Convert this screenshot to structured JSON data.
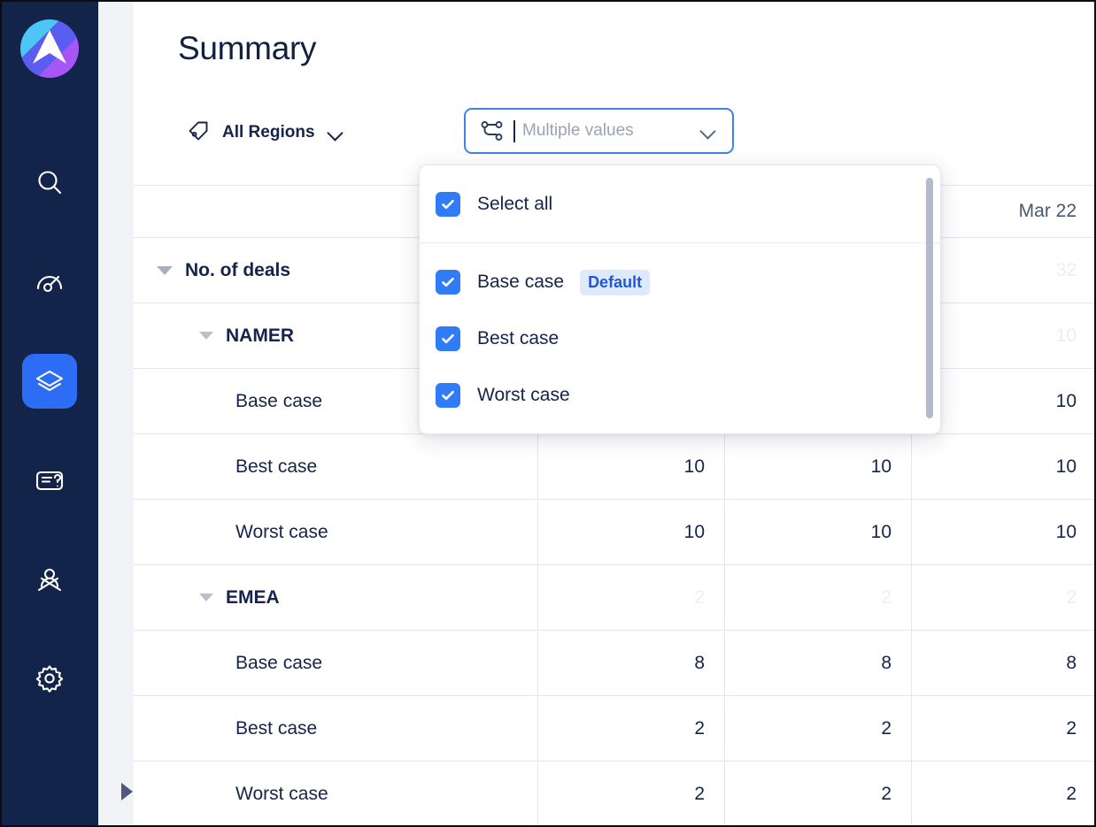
{
  "sidebar": {
    "logo_name": "atlas-logo",
    "items": [
      {
        "name": "search",
        "icon": "search-icon",
        "active": false
      },
      {
        "name": "dashboard",
        "icon": "gauge-icon",
        "active": false
      },
      {
        "name": "models",
        "icon": "layers-icon",
        "active": true
      },
      {
        "name": "help",
        "icon": "help-card-icon",
        "active": false
      },
      {
        "name": "people",
        "icon": "people-icon",
        "active": false
      },
      {
        "name": "settings",
        "icon": "gear-icon",
        "active": false
      }
    ]
  },
  "header": {
    "title": "Summary",
    "region_filter": {
      "label": "All Regions",
      "icon": "tag-icon"
    },
    "scenario_filter": {
      "placeholder": "Multiple values",
      "icon": "branch-icon"
    }
  },
  "dropdown": {
    "select_all_label": "Select all",
    "select_all_checked": true,
    "options": [
      {
        "label": "Base case",
        "badge": "Default",
        "checked": true
      },
      {
        "label": "Best case",
        "badge": "",
        "checked": true
      },
      {
        "label": "Worst case",
        "badge": "",
        "checked": true
      }
    ]
  },
  "table": {
    "columns": [
      "",
      "",
      "",
      "Mar 22"
    ],
    "rows": [
      {
        "label": "No. of deals",
        "indent": 0,
        "bold": true,
        "expander": "down",
        "faded": true,
        "values": [
          "",
          "",
          "32"
        ]
      },
      {
        "label": "NAMER",
        "indent": 1,
        "bold": true,
        "expander": "down",
        "faded": true,
        "values": [
          "",
          "",
          "10"
        ]
      },
      {
        "label": "Base case",
        "indent": 2,
        "bold": false,
        "expander": "",
        "faded": false,
        "values": [
          "",
          "",
          "10"
        ]
      },
      {
        "label": "Best case",
        "indent": 2,
        "bold": false,
        "expander": "",
        "faded": false,
        "values": [
          "10",
          "10",
          "10"
        ]
      },
      {
        "label": "Worst case",
        "indent": 2,
        "bold": false,
        "expander": "",
        "faded": false,
        "values": [
          "10",
          "10",
          "10"
        ]
      },
      {
        "label": "EMEA",
        "indent": 1,
        "bold": true,
        "expander": "down",
        "faded": true,
        "values": [
          "2",
          "2",
          "2"
        ]
      },
      {
        "label": "Base case",
        "indent": 2,
        "bold": false,
        "expander": "",
        "faded": false,
        "values": [
          "8",
          "8",
          "8"
        ]
      },
      {
        "label": "Best case",
        "indent": 2,
        "bold": false,
        "expander": "",
        "faded": false,
        "values": [
          "2",
          "2",
          "2"
        ]
      },
      {
        "label": "Worst case",
        "indent": 2,
        "bold": false,
        "expander": "",
        "faded": false,
        "values": [
          "2",
          "2",
          "2"
        ]
      }
    ]
  },
  "colors": {
    "sidebar_bg": "#13244a",
    "accent_blue": "#2f7cf6",
    "focus_border": "#3d82f0",
    "badge_bg": "#ddeafd",
    "badge_text": "#2156d6",
    "text_dark": "#16234a",
    "grid_line": "#e3e6eb"
  }
}
